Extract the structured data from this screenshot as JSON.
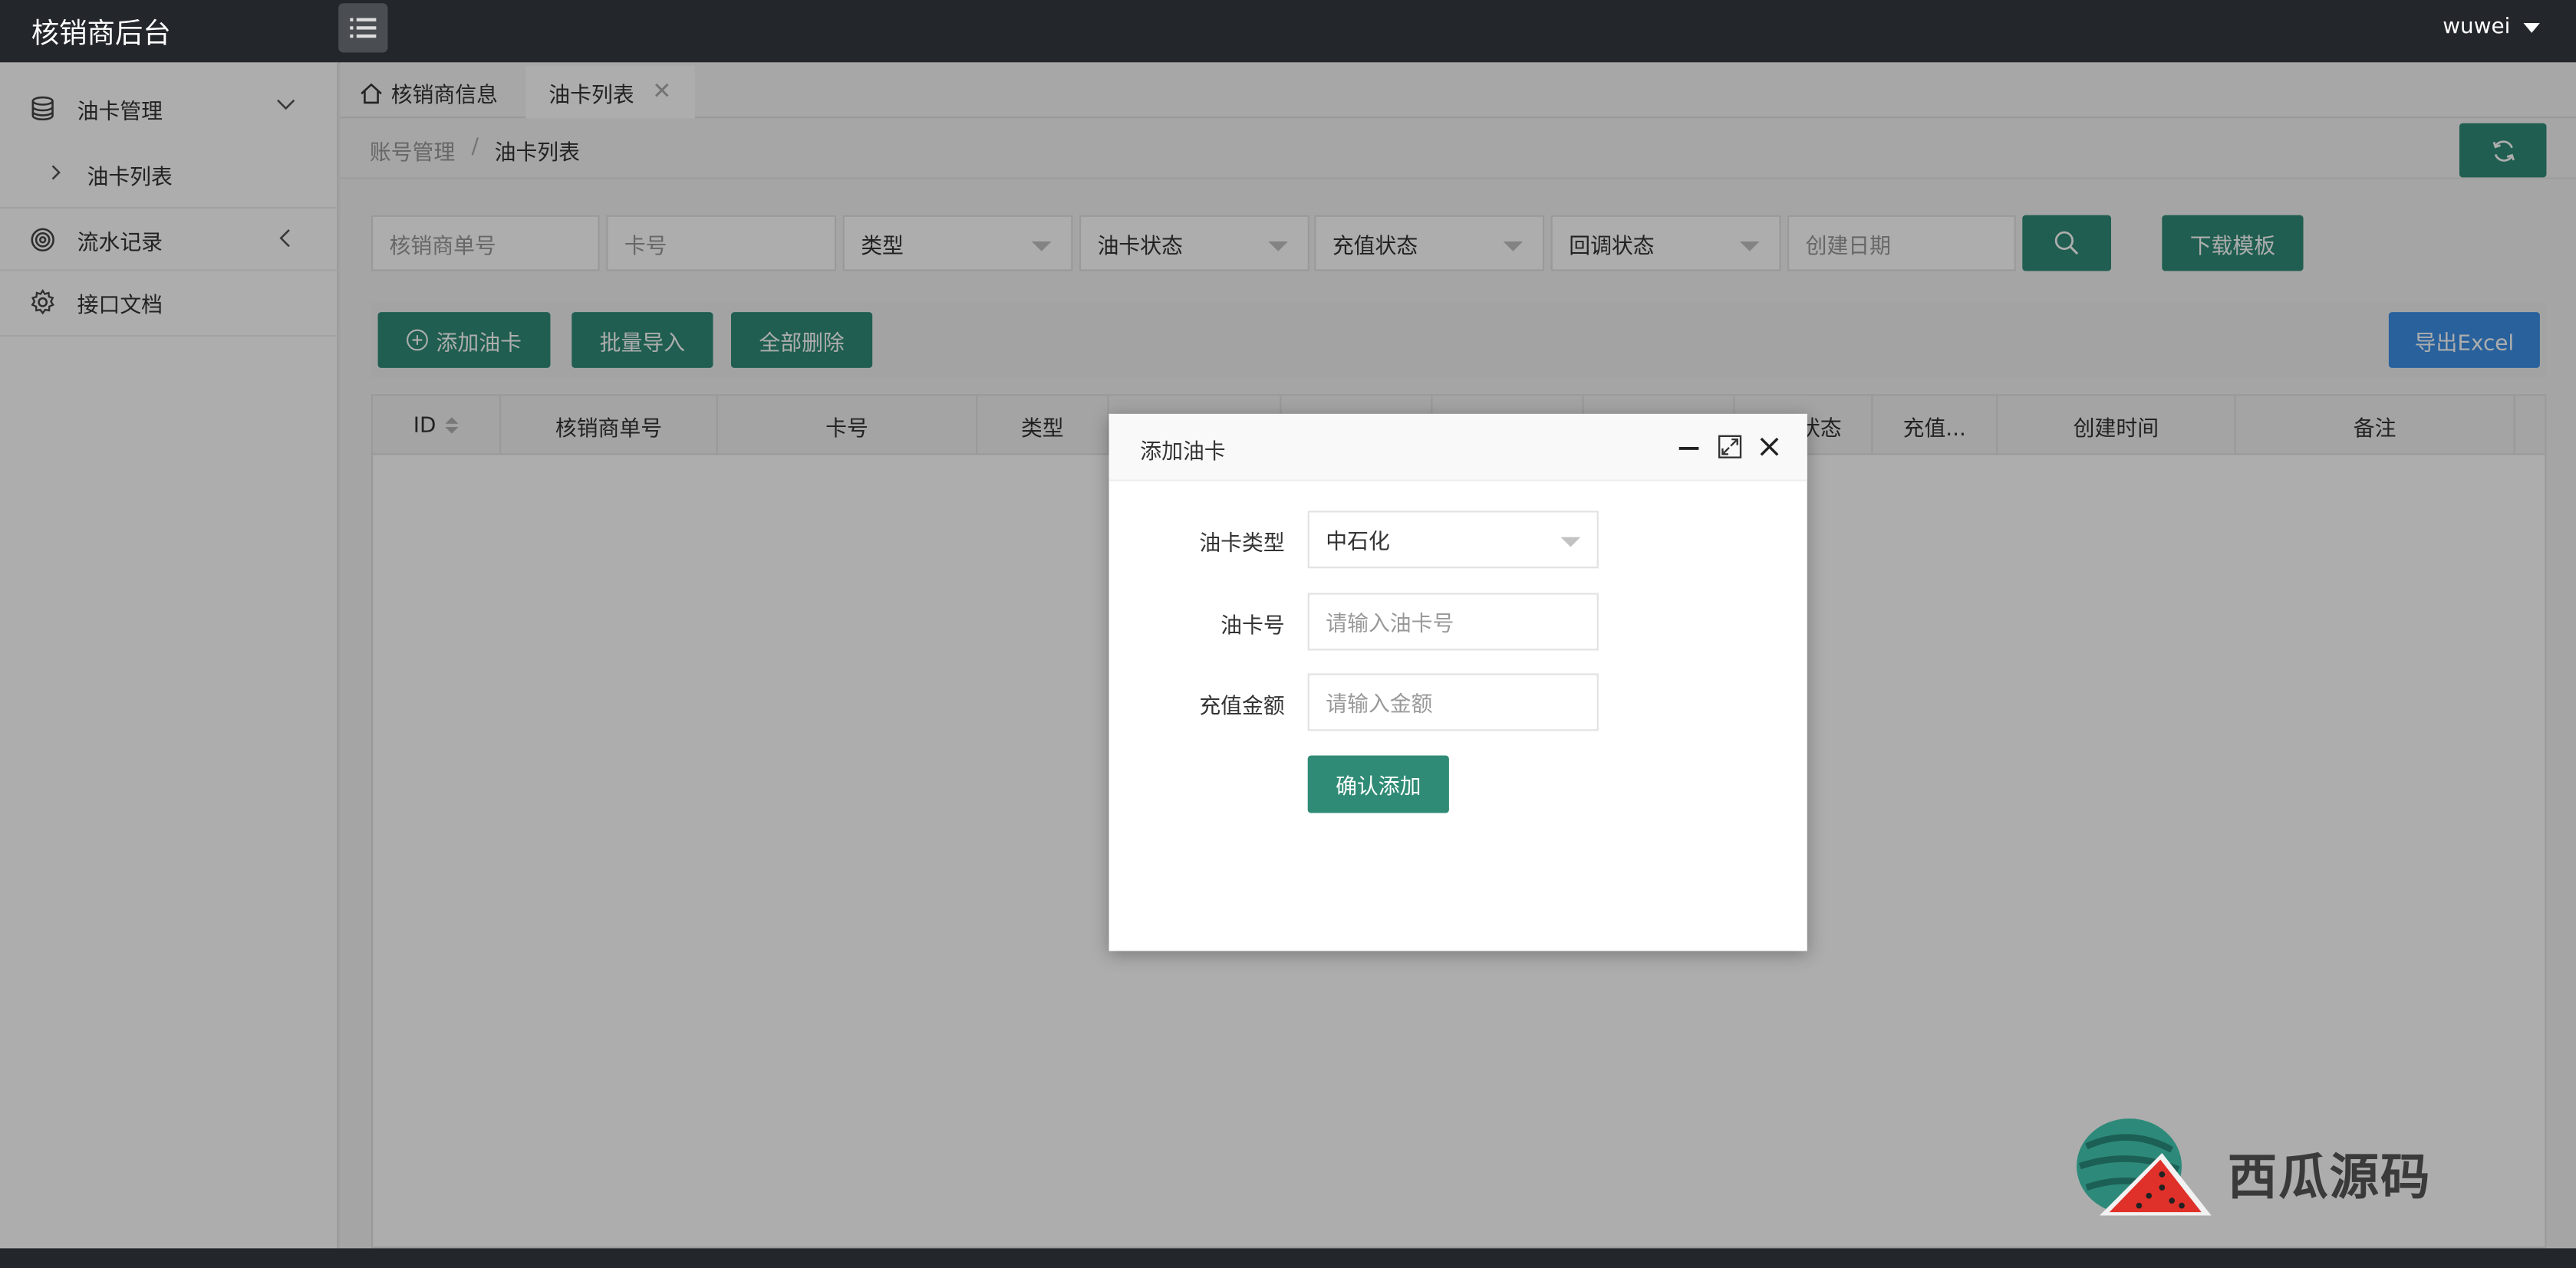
{
  "header": {
    "app_title": "核销商后台",
    "menu_toggle_icon": "list-icon",
    "username": "wuwei"
  },
  "sidebar": {
    "items": [
      {
        "label": "油卡管理",
        "icon": "database-icon",
        "expanded": true,
        "children": [
          {
            "label": "油卡列表"
          }
        ]
      },
      {
        "label": "流水记录",
        "icon": "spiral-icon",
        "expanded": false
      },
      {
        "label": "接口文档",
        "icon": "gear-icon"
      }
    ]
  },
  "tabs": [
    {
      "label": "核销商信息",
      "icon": "home-icon"
    },
    {
      "label": "油卡列表",
      "active": true,
      "close": "✕"
    }
  ],
  "breadcrumb": {
    "items": [
      "账号管理",
      "油卡列表"
    ],
    "separator": "/"
  },
  "filters": {
    "merchant_no_placeholder": "核销商单号",
    "card_no_placeholder": "卡号",
    "type_label": "类型",
    "card_status_label": "油卡状态",
    "recharge_status_label": "充值状态",
    "callback_status_label": "回调状态",
    "created_date_placeholder": "创建日期",
    "download_template_label": "下载模板"
  },
  "toolbar": {
    "add_card_label": "添加油卡",
    "batch_import_label": "批量导入",
    "delete_all_label": "全部删除",
    "export_excel_label": "导出Excel"
  },
  "table": {
    "columns": [
      "ID",
      "核销商单号",
      "卡号",
      "类型",
      "状态",
      "充值...",
      "创建时间",
      "备注"
    ]
  },
  "dialog": {
    "title": "添加油卡",
    "card_type_label": "油卡类型",
    "card_type_value": "中石化",
    "card_no_label": "油卡号",
    "card_no_placeholder": "请输入油卡号",
    "amount_label": "充值金额",
    "amount_placeholder": "请输入金额",
    "confirm_label": "确认添加"
  },
  "watermark": {
    "text": "西瓜源码"
  },
  "colors": {
    "primary": "#2f8b76",
    "export": "#3b8fe6",
    "topbar": "#23262b"
  }
}
